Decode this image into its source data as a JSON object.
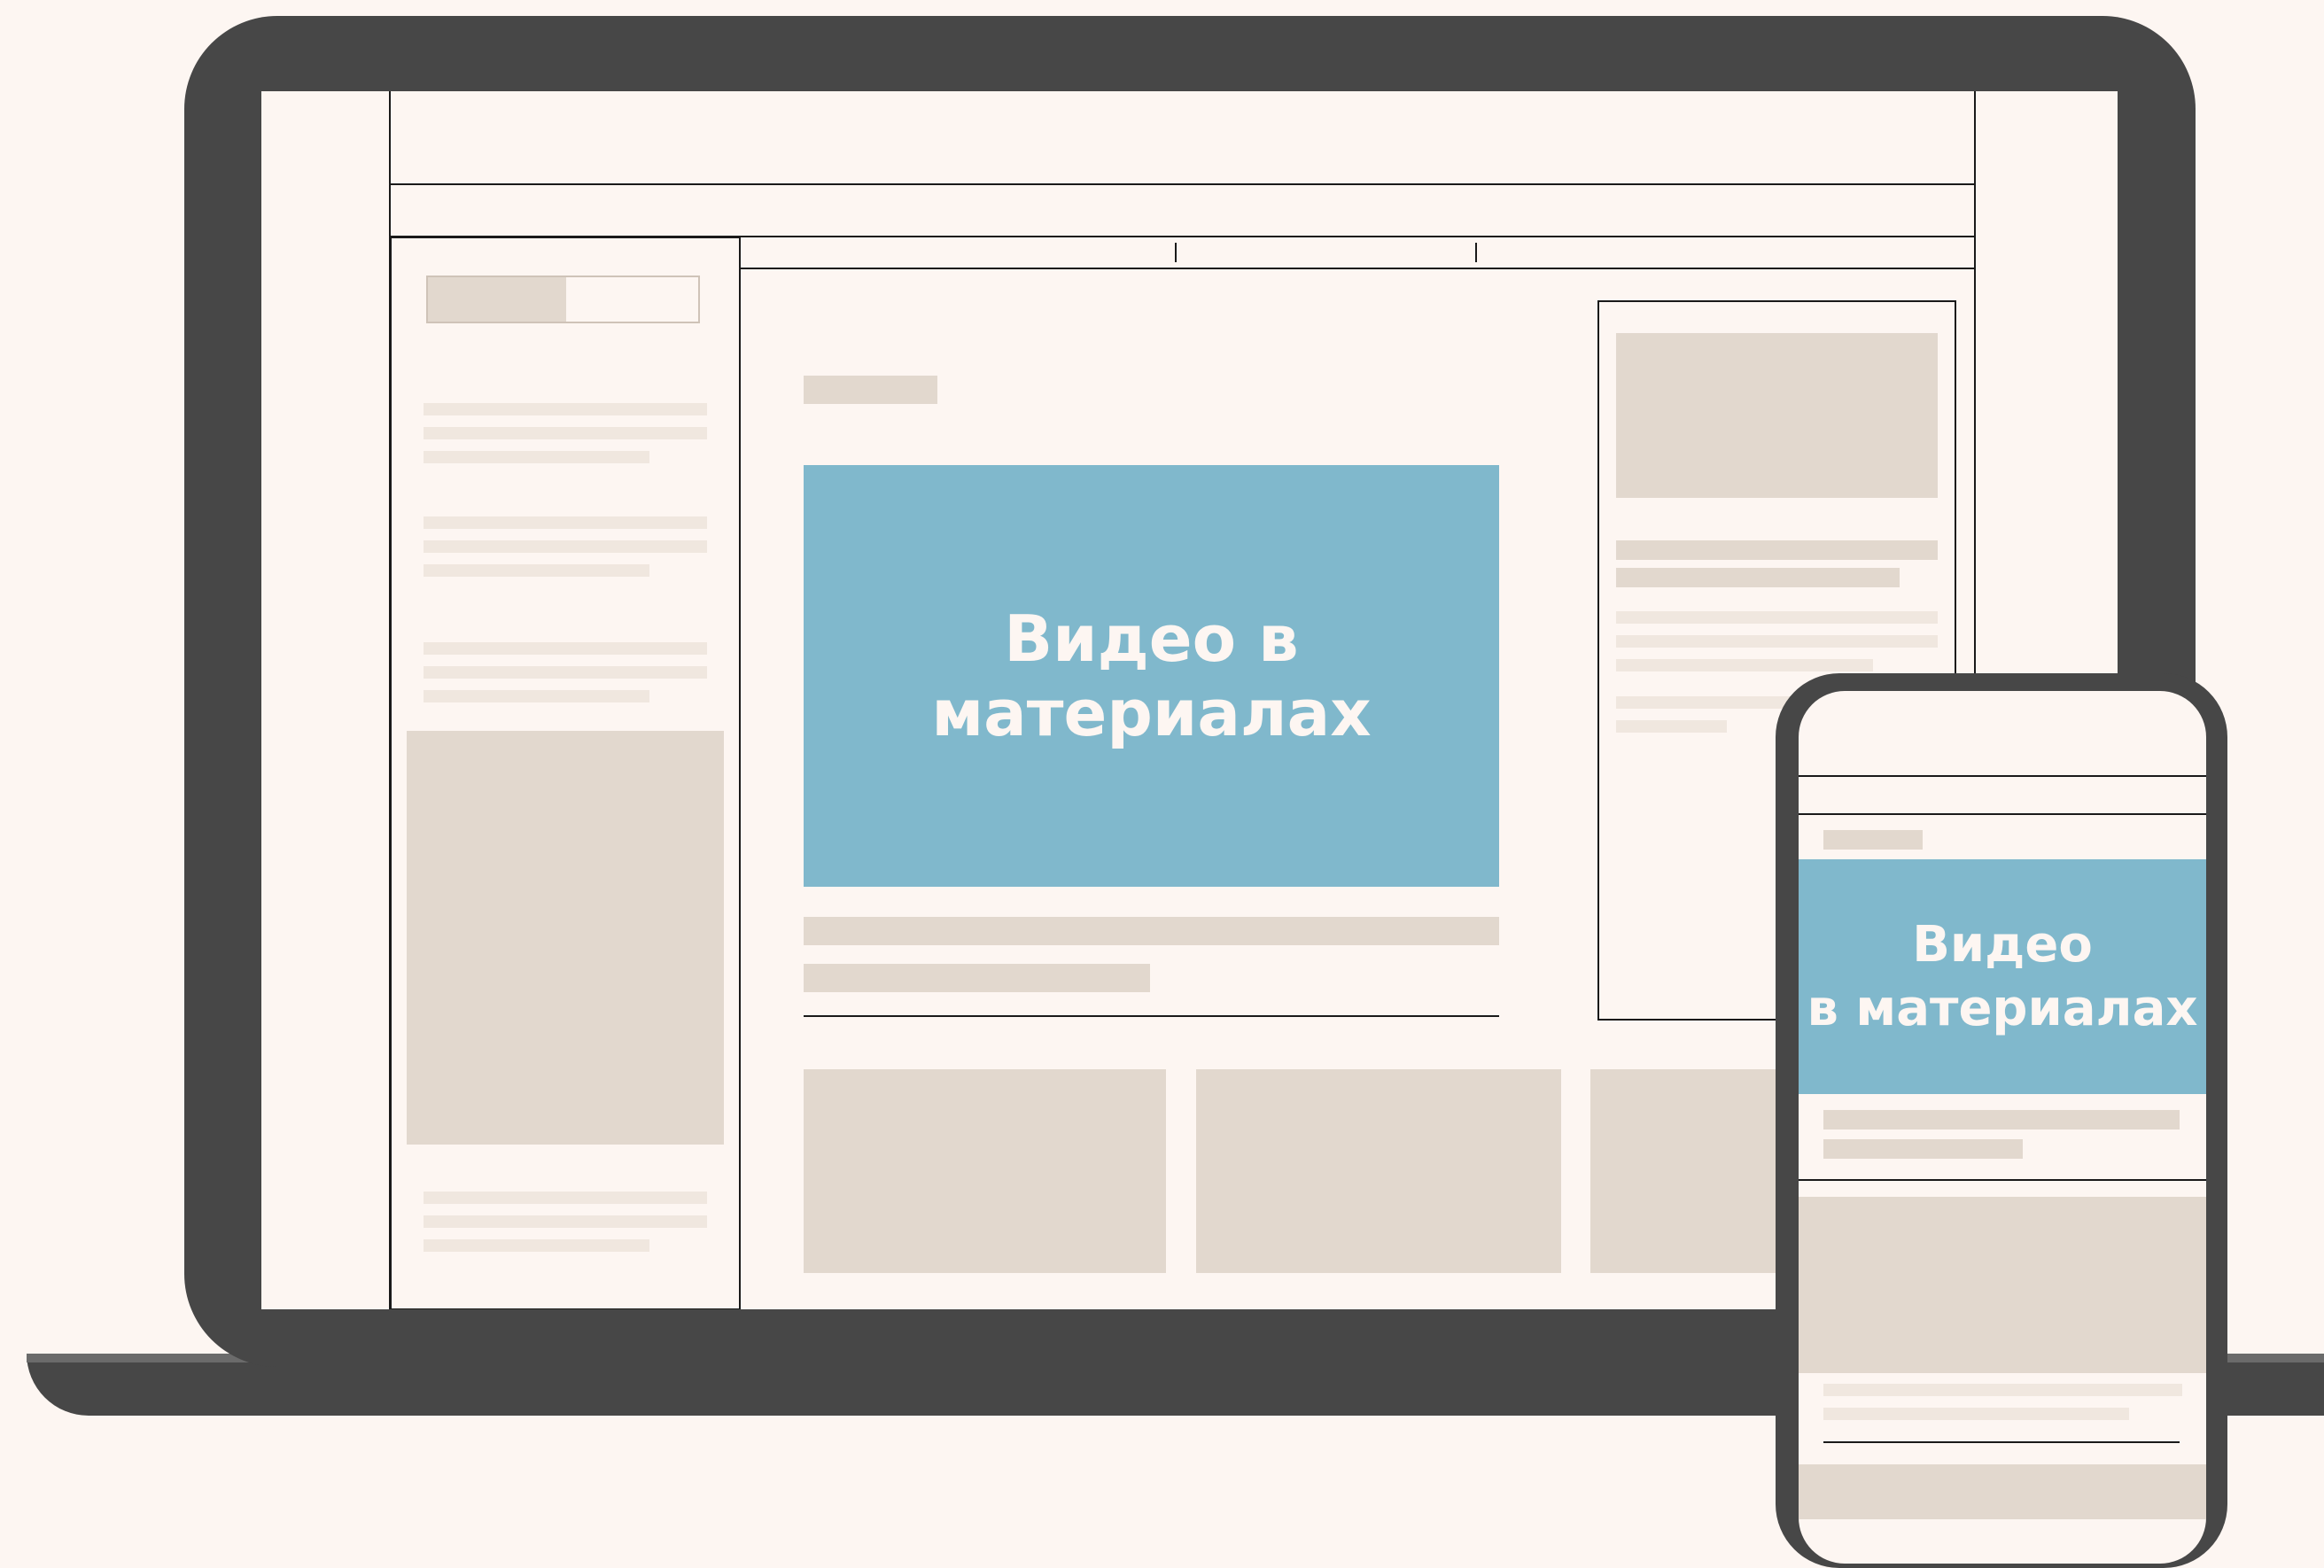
{
  "laptop": {
    "video_label": "Видео в материалах"
  },
  "phone": {
    "video_label": "Видео\nв материалах"
  },
  "colors": {
    "background": "#fdf6f2",
    "device": "#474747",
    "placeholder": "#e2d8ce",
    "video": "#80b8cc",
    "video_text": "#fdf6f2"
  }
}
